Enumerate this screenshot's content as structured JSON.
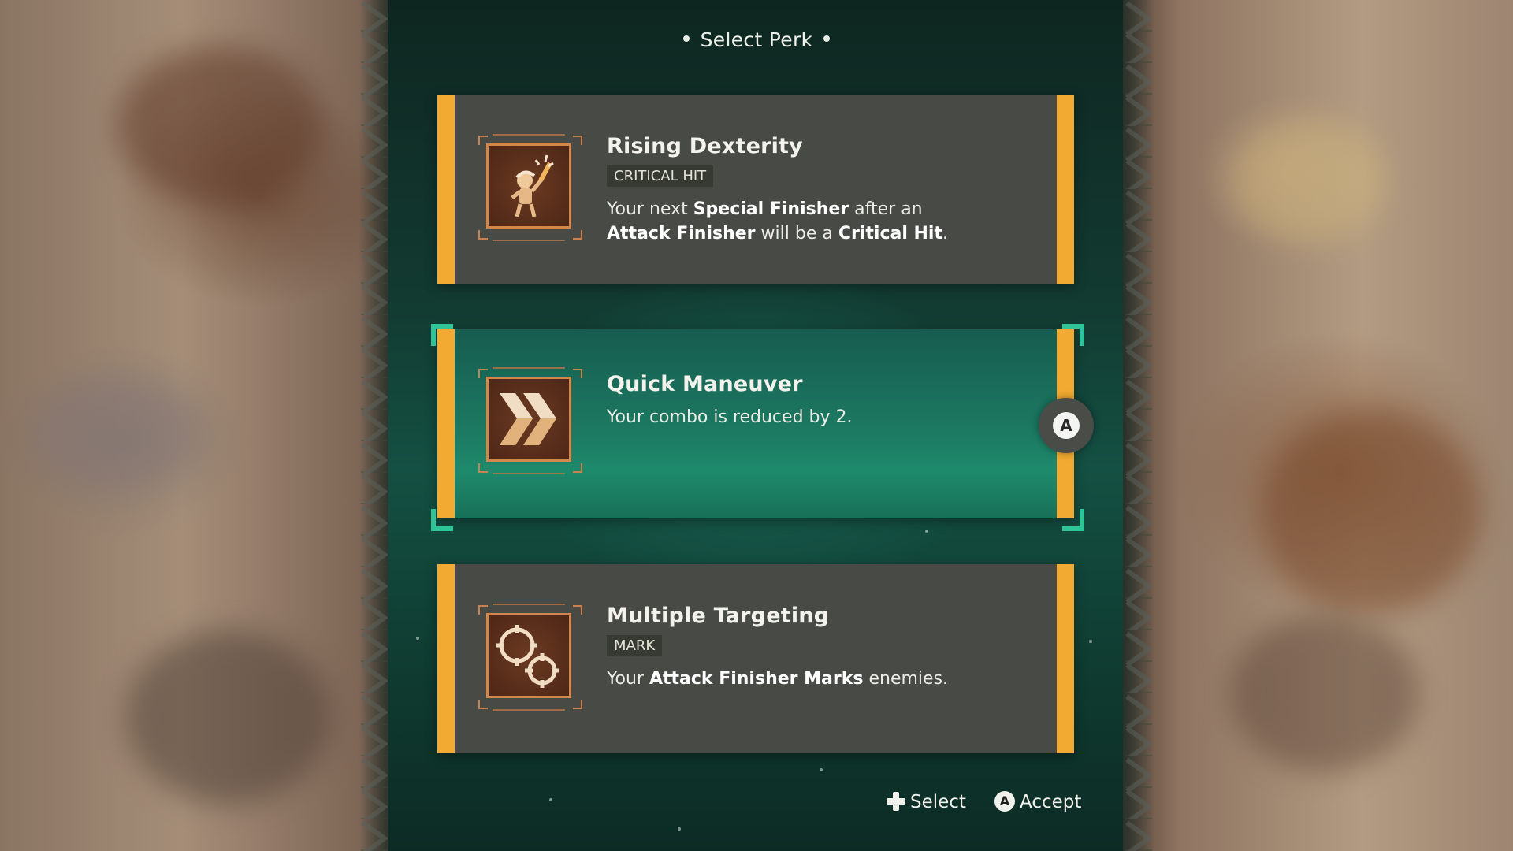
{
  "header": {
    "title": "Select Perk"
  },
  "perks": [
    {
      "name": "Rising Dexterity",
      "tag": "CRITICAL HIT",
      "icon": "dexterity-figure-icon",
      "description_parts": [
        {
          "t": "Your next ",
          "b": false
        },
        {
          "t": "Special Finisher",
          "b": true
        },
        {
          "t": " after an ",
          "b": false
        },
        {
          "t": "Attack Finisher",
          "b": true
        },
        {
          "t": " will be a ",
          "b": false
        },
        {
          "t": "Critical Hit",
          "b": true
        },
        {
          "t": ".",
          "b": false
        }
      ]
    },
    {
      "name": "Quick Maneuver",
      "tag": "",
      "icon": "double-chevron-icon",
      "selected": true,
      "description_parts": [
        {
          "t": "Your combo is reduced by 2.",
          "b": false
        }
      ]
    },
    {
      "name": "Multiple Targeting",
      "tag": "MARK",
      "icon": "crosshairs-icon",
      "description_parts": [
        {
          "t": "Your ",
          "b": false
        },
        {
          "t": "Attack Finisher Marks",
          "b": true
        },
        {
          "t": " enemies.",
          "b": false
        }
      ]
    }
  ],
  "selected_button": {
    "label": "A"
  },
  "footer": {
    "select_label": "Select",
    "accept_button": "A",
    "accept_label": "Accept"
  },
  "colors": {
    "accent_bar": "#f2aa32",
    "selection": "#2ec497",
    "card_bg": "#484a45",
    "selected_bg": "#1c7a62"
  }
}
